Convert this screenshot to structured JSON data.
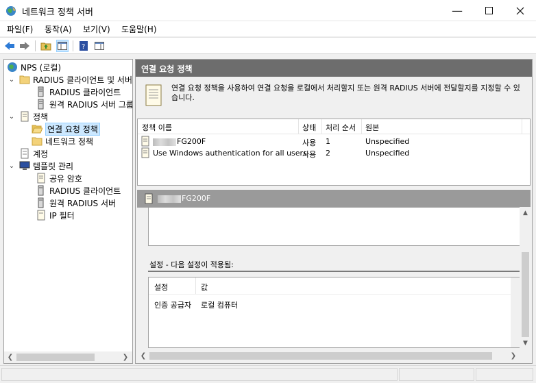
{
  "window": {
    "title": "네트워크 정책 서버"
  },
  "menu": [
    {
      "label": "파일(F)"
    },
    {
      "label": "동작(A)"
    },
    {
      "label": "보기(V)"
    },
    {
      "label": "도움말(H)"
    }
  ],
  "tree": {
    "root": "NPS (로컬)",
    "radius_clients": "RADIUS 클라이언트 및 서버",
    "radius_client": "RADIUS 클라이언트",
    "remote_radius_group": "원격 RADIUS 서버 그룹",
    "policies": "정책",
    "connection_request_policies": "연결 요청 정책",
    "network_policies": "네트워크 정책",
    "accounting": "계정",
    "template_management": "템플릿 관리",
    "shared_secrets": "공유 암호",
    "t_radius_clients": "RADIUS 클라이언트",
    "t_remote_radius": "원격 RADIUS 서버",
    "ip_filters": "IP 필터"
  },
  "main": {
    "header": "연결 요청 정책",
    "description": "연결 요청 정책을 사용하여 연결 요청을 로컬에서 처리할지 또는 원격 RADIUS 서버에 전달할지를 지정할 수 있습니다.",
    "columns": {
      "name": "정책 이름",
      "status": "상태",
      "order": "처리 순서",
      "source": "원본"
    },
    "rows": [
      {
        "name": "FG200F",
        "status": "사용",
        "order": "1",
        "source": "Unspecified"
      },
      {
        "name": "Use Windows authentication for all users",
        "status": "사용",
        "order": "2",
        "source": "Unspecified"
      }
    ],
    "detail_title": "FG200F",
    "settings_title": "설정 - 다음 설정이 적용됨:",
    "settings_columns": {
      "setting": "설정",
      "value": "값"
    },
    "settings_rows": [
      {
        "setting": "인증 공급자",
        "value": "로컬 컴퓨터"
      }
    ]
  }
}
